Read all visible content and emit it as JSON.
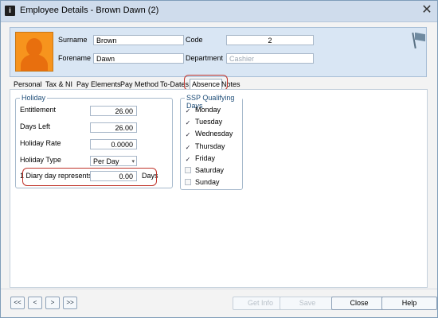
{
  "window": {
    "title": "Employee Details - Brown Dawn (2)",
    "close_glyph": "✕"
  },
  "header": {
    "surname_label": "Surname",
    "surname_value": "Brown",
    "forename_label": "Forename 1",
    "forename_value": "Dawn",
    "code_label": "Code",
    "code_value": "2",
    "department_label": "Department",
    "department_placeholder": "Cashier",
    "photo_icon": "person-silhouette-icon",
    "flag_icon": "flag-icon"
  },
  "tabs": [
    {
      "label": "Personal"
    },
    {
      "label": "Tax & NI"
    },
    {
      "label": "Pay Elements"
    },
    {
      "label": "Pay Method"
    },
    {
      "label": "To-Dates"
    },
    {
      "label": "Absence"
    },
    {
      "label": "Notes"
    }
  ],
  "holiday": {
    "group_title": "Holiday",
    "entitlement_label": "Entitlement",
    "entitlement_value": "26.00",
    "days_left_label": "Days Left",
    "days_left_value": "26.00",
    "holiday_rate_label": "Holiday Rate",
    "holiday_rate_value": "0.0000",
    "holiday_type_label": "Holiday Type",
    "holiday_type_value": "Per Day",
    "diary_day_label": "1 Diary day represents",
    "diary_day_value": "0.00",
    "diary_day_unit": "Days"
  },
  "ssp": {
    "group_title": "SSP Qualifying Days",
    "days": [
      {
        "label": "Monday",
        "checked": true
      },
      {
        "label": "Tuesday",
        "checked": true
      },
      {
        "label": "Wednesday",
        "checked": true
      },
      {
        "label": "Thursday",
        "checked": true
      },
      {
        "label": "Friday",
        "checked": true
      },
      {
        "label": "Saturday",
        "checked": false
      },
      {
        "label": "Sunday",
        "checked": false
      }
    ]
  },
  "footer": {
    "nav": [
      "<<",
      "<",
      ">",
      ">>"
    ],
    "get_info_label": "Get Info",
    "save_label": "Save",
    "close_label": "Close",
    "help_label": "Help"
  },
  "colors": {
    "highlight": "#c0342b",
    "header_bg": "#d9e6f4",
    "photo": "#f7941d",
    "group_title": "#1f4e79"
  }
}
